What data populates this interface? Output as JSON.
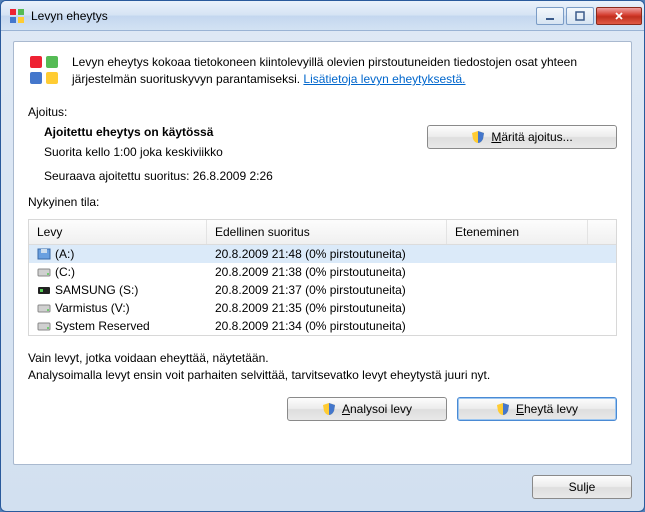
{
  "window": {
    "title": "Levyn eheytys"
  },
  "intro": {
    "text": "Levyn eheytys kokoaa tietokoneen kiintolevyillä olevien pirstoutuneiden tiedostojen osat yhteen järjestelmän suorituskyvyn parantamiseksi. ",
    "link": "Lisätietoja levyn eheytyksestä."
  },
  "labels": {
    "scheduling": "Ajoitus:",
    "current_state": "Nykyinen tila:"
  },
  "schedule": {
    "status": "Ajoitettu eheytys on käytössä",
    "detail": "Suorita kello 1:00 joka keskiviikko",
    "next_run": "Seuraava ajoitettu suoritus: 26.8.2009 2:26"
  },
  "buttons": {
    "configure": "äritä ajoitus...",
    "configure_prefix": "M",
    "analyze": "nalysoi levy",
    "analyze_prefix": "A",
    "defrag": "heytä levy",
    "defrag_prefix": "E",
    "close": "Sulje"
  },
  "table": {
    "headers": {
      "disk": "Levy",
      "last_run": "Edellinen suoritus",
      "progress": "Eteneminen"
    },
    "rows": [
      {
        "name": "(A:)",
        "last": "20.8.2009 21:48 (0% pirstoutuneita)",
        "icon": "floppy"
      },
      {
        "name": "(C:)",
        "last": "20.8.2009 21:38 (0% pirstoutuneita)",
        "icon": "hdd"
      },
      {
        "name": "SAMSUNG (S:)",
        "last": "20.8.2009 21:37 (0% pirstoutuneita)",
        "icon": "ext"
      },
      {
        "name": "Varmistus (V:)",
        "last": "20.8.2009 21:35 (0% pirstoutuneita)",
        "icon": "hdd"
      },
      {
        "name": "System Reserved",
        "last": "20.8.2009 21:34 (0% pirstoutuneita)",
        "icon": "hdd"
      }
    ]
  },
  "note": {
    "line1": "Vain levyt, jotka voidaan eheyttää, näytetään.",
    "line2": "Analysoimalla levyt ensin voit parhaiten selvittää, tarvitsevatko levyt eheytystä juuri nyt."
  }
}
